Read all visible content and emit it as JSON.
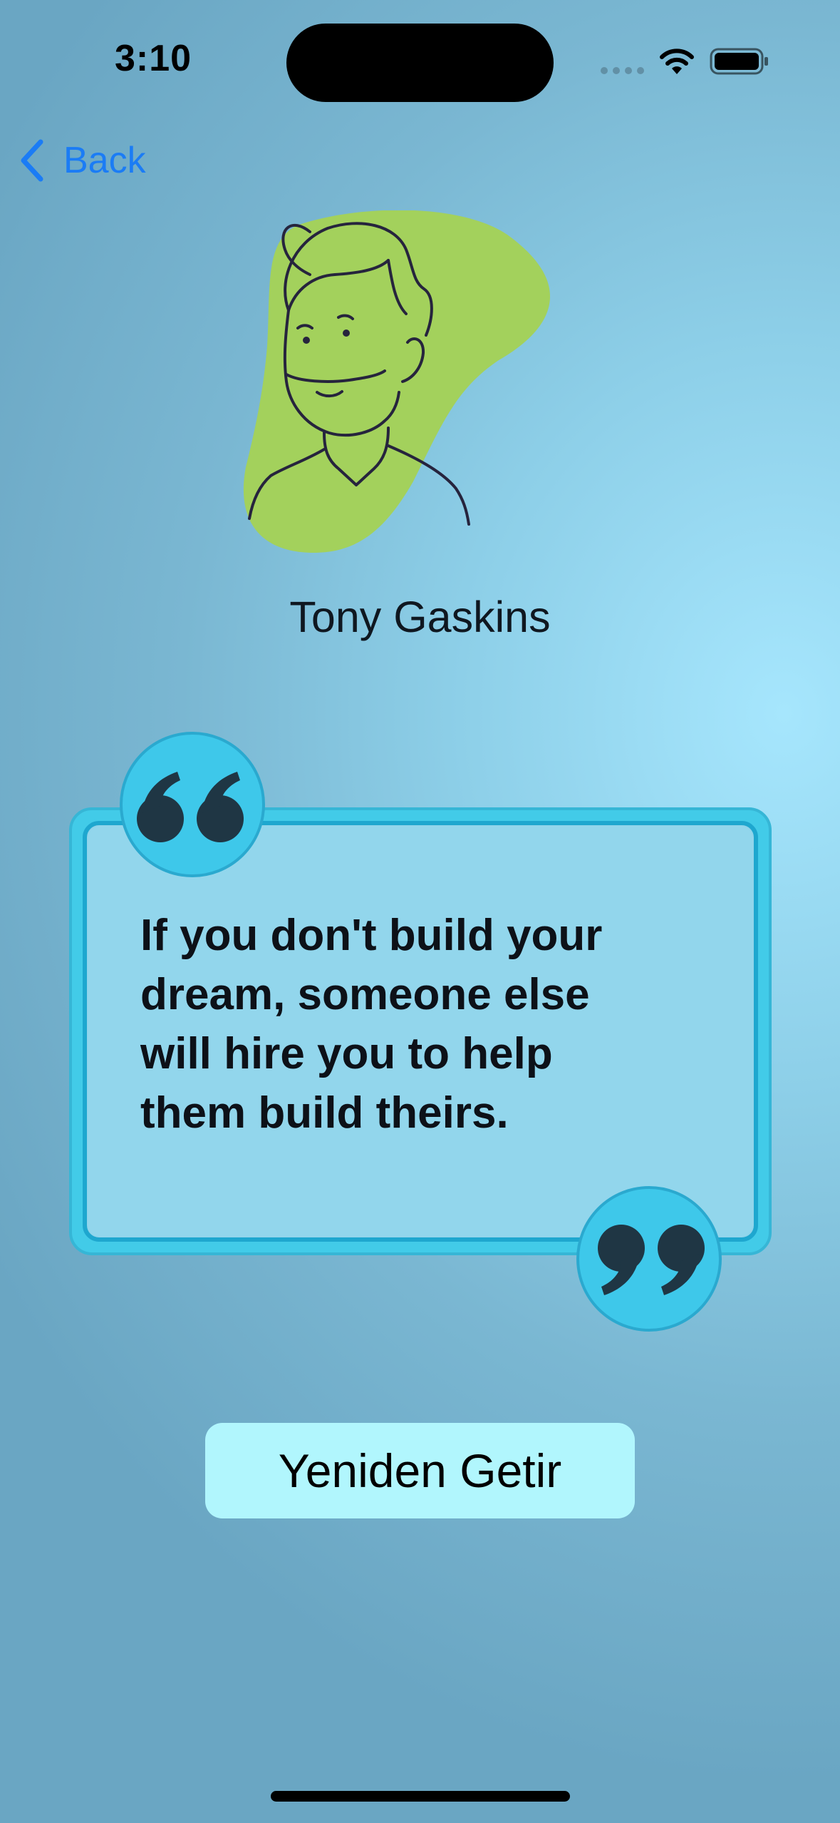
{
  "status_bar": {
    "time": "3:10",
    "icons": [
      "cellular-signal-icon",
      "wifi-icon",
      "battery-icon"
    ]
  },
  "nav": {
    "back_label": "Back",
    "back_icon": "chevron-left-icon"
  },
  "author": {
    "name": "Tony Gaskins",
    "illustration": "man-portrait-illustration"
  },
  "quote": {
    "text": "If you don't build your dream, someone else will hire you to help them build theirs.",
    "open_icon": "open-quote-icon",
    "close_icon": "close-quote-icon"
  },
  "actions": {
    "reload_label": "Yeniden Getir"
  },
  "colors": {
    "accent": "#1b7cf5",
    "button_bg": "#b1f6fd",
    "frame": "#3fcbe9",
    "avatar_blob": "#a3d15c"
  }
}
